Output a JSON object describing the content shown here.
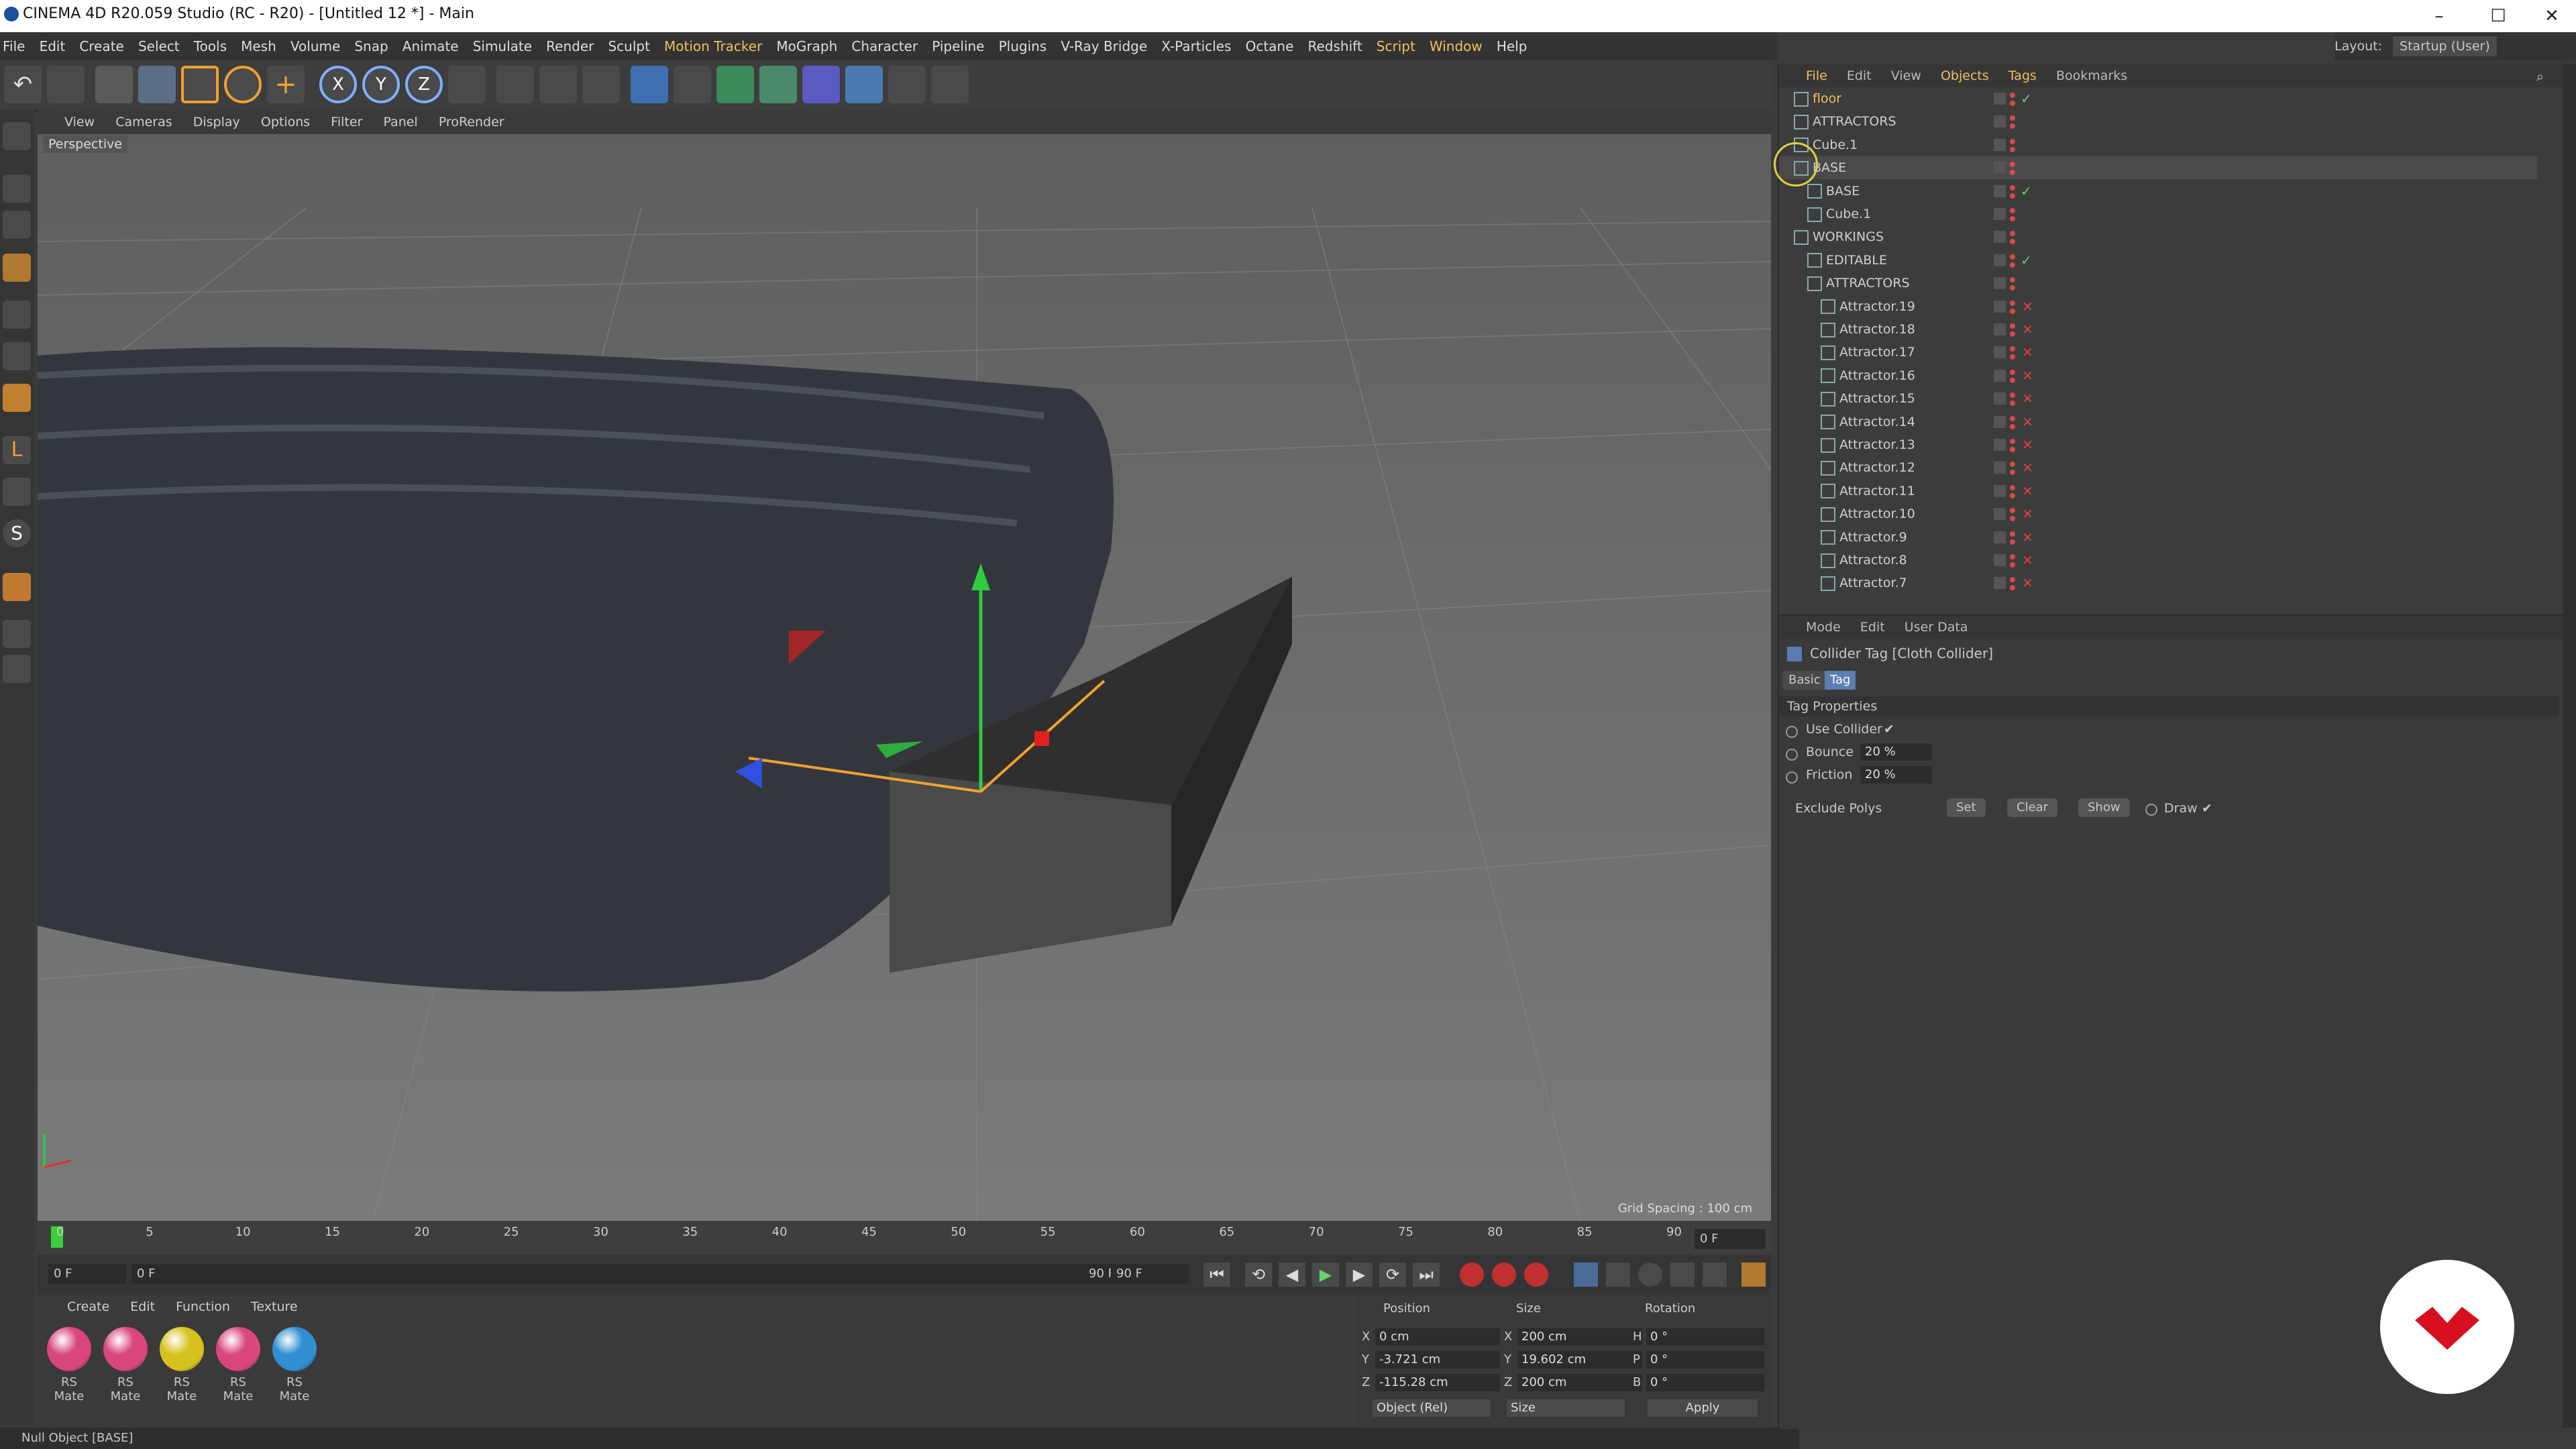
{
  "window": {
    "title": "CINEMA 4D R20.059 Studio (RC - R20) - [Untitled 12 *] - Main",
    "controls": [
      "–",
      "☐",
      "✕"
    ]
  },
  "menubar": {
    "items": [
      "File",
      "Edit",
      "Create",
      "Select",
      "Tools",
      "Mesh",
      "Volume",
      "Snap",
      "Animate",
      "Simulate",
      "Sculpt",
      "Render",
      "Sculpt",
      "Motion Tracker",
      "MoGraph",
      "Character",
      "Pipeline",
      "Plugins",
      "V-Ray Bridge",
      "X-Particles",
      "Octane",
      "Redshift",
      "Script",
      "Window",
      "Help"
    ],
    "layout_label": "Layout:",
    "layout_value": "Startup (User)"
  },
  "viewport": {
    "menu": [
      "View",
      "Cameras",
      "Display",
      "Options",
      "Filter",
      "Panel",
      "ProRender"
    ],
    "label": "Perspective",
    "grid_spacing": "Grid Spacing : 100 cm"
  },
  "timeline": {
    "ticks": [
      "0",
      "5",
      "10",
      "15",
      "20",
      "25",
      "30",
      "35",
      "40",
      "45",
      "50",
      "55",
      "60",
      "65",
      "70",
      "75",
      "80",
      "85",
      "90"
    ],
    "frame_end_field": "0 F",
    "start_field": "0 F",
    "range_start": "0 F",
    "range_end": "90 F",
    "max_field": "90 F"
  },
  "materials": {
    "menu": [
      "Create",
      "Edit",
      "Function",
      "Texture"
    ],
    "items": [
      {
        "label": "RS Mate",
        "color": "#d9467d"
      },
      {
        "label": "RS Mate",
        "color": "#d9467d"
      },
      {
        "label": "RS Mate",
        "color": "#d6c21e"
      },
      {
        "label": "RS Mate",
        "color": "#d9467d"
      },
      {
        "label": "RS Mate",
        "color": "#2f8fd0"
      }
    ]
  },
  "coordinates": {
    "headers": [
      "Position",
      "Size",
      "Rotation"
    ],
    "rows": [
      {
        "axis": "X",
        "pos": "0 cm",
        "size_axis": "X",
        "size": "200 cm",
        "rot_axis": "H",
        "rot": "0 °"
      },
      {
        "axis": "Y",
        "pos": "-3.721 cm",
        "size_axis": "Y",
        "size": "19.602 cm",
        "rot_axis": "P",
        "rot": "0 °"
      },
      {
        "axis": "Z",
        "pos": "-115.28 cm",
        "size_axis": "Z",
        "size": "200 cm",
        "rot_axis": "B",
        "rot": "0 °"
      }
    ],
    "mode": "Object (Rel)",
    "size_mode": "Size",
    "apply": "Apply"
  },
  "status": "Null Object [BASE]",
  "object_manager": {
    "menu": [
      "File",
      "Edit",
      "View",
      "Objects",
      "Tags",
      "Bookmarks"
    ],
    "rows": [
      {
        "name": "floor",
        "indent": 0,
        "flag": "check"
      },
      {
        "name": "ATTRACTORS",
        "indent": 0,
        "flag": "dots"
      },
      {
        "name": "Cube.1",
        "indent": 0,
        "flag": "dots"
      },
      {
        "name": "BASE",
        "indent": 0,
        "flag": "dots"
      },
      {
        "name": "BASE",
        "indent": 1,
        "flag": "check"
      },
      {
        "name": "Cube.1",
        "indent": 1,
        "flag": "dots"
      },
      {
        "name": "WORKINGS",
        "indent": 0,
        "flag": "dots"
      },
      {
        "name": "EDITABLE",
        "indent": 1,
        "flag": "check"
      },
      {
        "name": "ATTRACTORS",
        "indent": 1,
        "flag": "dots"
      },
      {
        "name": "Attractor.19",
        "indent": 2,
        "flag": "x"
      },
      {
        "name": "Attractor.18",
        "indent": 2,
        "flag": "x"
      },
      {
        "name": "Attractor.17",
        "indent": 2,
        "flag": "x"
      },
      {
        "name": "Attractor.16",
        "indent": 2,
        "flag": "x"
      },
      {
        "name": "Attractor.15",
        "indent": 2,
        "flag": "x"
      },
      {
        "name": "Attractor.14",
        "indent": 2,
        "flag": "x"
      },
      {
        "name": "Attractor.13",
        "indent": 2,
        "flag": "x"
      },
      {
        "name": "Attractor.12",
        "indent": 2,
        "flag": "x"
      },
      {
        "name": "Attractor.11",
        "indent": 2,
        "flag": "x"
      },
      {
        "name": "Attractor.10",
        "indent": 2,
        "flag": "x"
      },
      {
        "name": "Attractor.9",
        "indent": 2,
        "flag": "x"
      },
      {
        "name": "Attractor.8",
        "indent": 2,
        "flag": "x"
      },
      {
        "name": "Attractor.7",
        "indent": 2,
        "flag": "x"
      }
    ]
  },
  "attribute_manager": {
    "menu": [
      "Mode",
      "Edit",
      "User Data"
    ],
    "title": "Collider Tag [Cloth Collider]",
    "tabs": [
      "Basic",
      "Tag"
    ],
    "section": "Tag Properties",
    "use_collider": "Use Collider",
    "use_collider_value": "✔",
    "bounce_label": "Bounce",
    "bounce_value": "20 %",
    "friction_label": "Friction",
    "friction_value": "20 %",
    "exclude_label": "Exclude Polys",
    "buttons": [
      "Set",
      "Clear",
      "Show"
    ],
    "draw_label": "Draw",
    "draw_value": "✔"
  },
  "colors": {
    "accent_orange": "#f0a030",
    "ui_dark": "#3b3b3b",
    "logo_red": "#d6101e"
  }
}
